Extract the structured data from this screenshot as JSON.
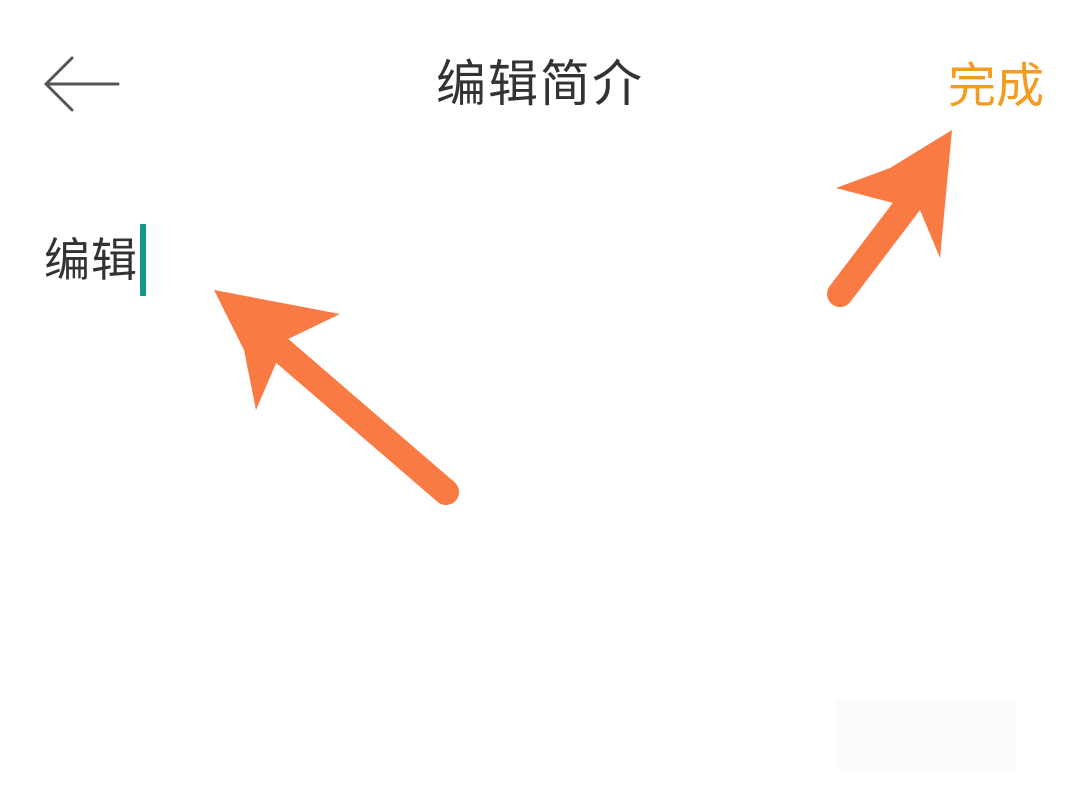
{
  "header": {
    "back_icon": "arrow-left-icon",
    "title": "编辑简介",
    "done_label": "完成"
  },
  "editor": {
    "value": "编辑"
  },
  "colors": {
    "accent": "#F39C1F",
    "caret": "#14968A",
    "annotation_arrow": "#F97A42",
    "title_text": "#333333"
  }
}
